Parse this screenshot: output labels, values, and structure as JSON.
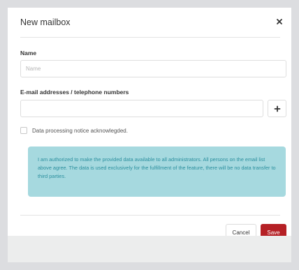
{
  "modal": {
    "title": "New mailbox"
  },
  "form": {
    "name_label": "Name",
    "name_placeholder": "Name",
    "name_value": "",
    "email_label": "E-mail addresses / telephone numbers",
    "email_placeholder": "",
    "email_value": "",
    "checkbox_label": "Data processing notice acknowlegded.",
    "checkbox_checked": false
  },
  "notice": {
    "text": "I am authorized to make the provided data available to all administrators. All persons on the email list above agree. The data is used exclusively for the fulfillment of the feature, there will be no data transfer to third parties."
  },
  "footer": {
    "cancel_label": "Cancel",
    "save_label": "Save"
  },
  "colors": {
    "save_button": "#b52025",
    "notice_background": "#a6d9df",
    "notice_text": "#2b8f9e"
  },
  "icons": {
    "close": "close-icon",
    "add": "plus-icon"
  }
}
